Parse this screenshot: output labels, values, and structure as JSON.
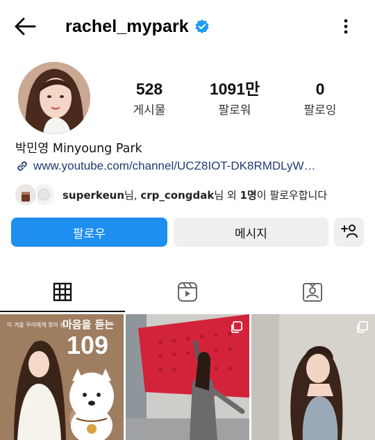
{
  "header": {
    "username": "rachel_mypark"
  },
  "stats": [
    {
      "value": "528",
      "label": "게시물"
    },
    {
      "value": "1091만",
      "label": "팔로워"
    },
    {
      "value": "0",
      "label": "팔로잉"
    }
  ],
  "profile": {
    "full_name": "박민영 Minyoung Park",
    "link": "www.youtube.com/channel/UCZ8IOT-DK8RMDLyW…"
  },
  "followed_by": {
    "user1": "superkeun",
    "suffix1": "님, ",
    "user2": "crp_congdak",
    "suffix2": "님 외 ",
    "count": "1명",
    "tail": "이 팔로우합니다"
  },
  "actions": {
    "follow_label": "팔로우",
    "message_label": "메시지"
  },
  "tabs": [
    {
      "icon": "grid-icon",
      "active": true
    },
    {
      "icon": "reels-icon",
      "active": false
    },
    {
      "icon": "tagged-icon",
      "active": false
    }
  ],
  "posts": [
    {
      "small_text": "이 겨울 우리에게 찾아 온",
      "big_text": "마음을 듣는",
      "number": "109",
      "multi": false
    },
    {
      "multi": true
    },
    {
      "multi": true
    }
  ],
  "colors": {
    "accent_blue": "#1e8fef",
    "verified_blue": "#1d9bf0",
    "link_color": "#1f3b73",
    "button_gray": "#efefef"
  }
}
